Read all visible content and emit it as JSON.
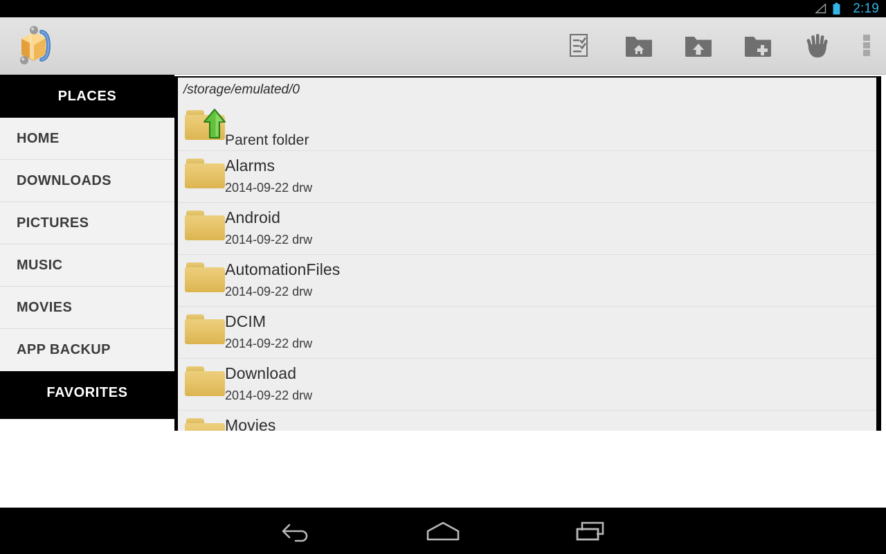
{
  "statusbar": {
    "time": "2:19",
    "accent_color": "#33b5e5",
    "icons": [
      "signal-triangle-icon",
      "battery-icon"
    ]
  },
  "actionbar": {
    "app_logo_name": "androzip-logo",
    "background_color": "#dcdcdc",
    "actions": [
      {
        "id": "checklist",
        "icon": "checklist-icon",
        "label": "Select / checklist"
      },
      {
        "id": "home",
        "icon": "folder-home-icon",
        "label": "Home folder"
      },
      {
        "id": "up",
        "icon": "folder-up-icon",
        "label": "Up one folder"
      },
      {
        "id": "new",
        "icon": "folder-add-icon",
        "label": "New folder"
      },
      {
        "id": "hand",
        "icon": "hand-icon",
        "label": "Paste / hand"
      },
      {
        "id": "overflow",
        "icon": "overflow-menu-icon",
        "label": "More options"
      }
    ]
  },
  "sidebar": {
    "sections": [
      {
        "header": "PLACES",
        "items": [
          {
            "label": "HOME"
          },
          {
            "label": "DOWNLOADS"
          },
          {
            "label": "PICTURES"
          },
          {
            "label": "MUSIC"
          },
          {
            "label": "MOVIES"
          },
          {
            "label": "APP BACKUP"
          }
        ]
      },
      {
        "header": "FAVORITES",
        "items": []
      }
    ]
  },
  "filepanel": {
    "path": "/storage/emulated/0",
    "parent": {
      "name": "Parent folder",
      "icon": "folder-up-green-arrow-icon"
    },
    "entries": [
      {
        "name": "Alarms",
        "meta": "2014-09-22 drw",
        "icon": "folder-icon"
      },
      {
        "name": "Android",
        "meta": "2014-09-22 drw",
        "icon": "folder-icon"
      },
      {
        "name": "AutomationFiles",
        "meta": "2014-09-22 drw",
        "icon": "folder-icon"
      },
      {
        "name": "DCIM",
        "meta": "2014-09-22 drw",
        "icon": "folder-icon"
      },
      {
        "name": "Download",
        "meta": "2014-09-22 drw",
        "icon": "folder-icon"
      },
      {
        "name": "Movies",
        "meta": "",
        "icon": "folder-icon"
      }
    ]
  },
  "navbar": {
    "buttons": [
      {
        "id": "back",
        "icon": "back-arrow-icon"
      },
      {
        "id": "home",
        "icon": "home-icon"
      },
      {
        "id": "recents",
        "icon": "recents-icon"
      }
    ]
  }
}
